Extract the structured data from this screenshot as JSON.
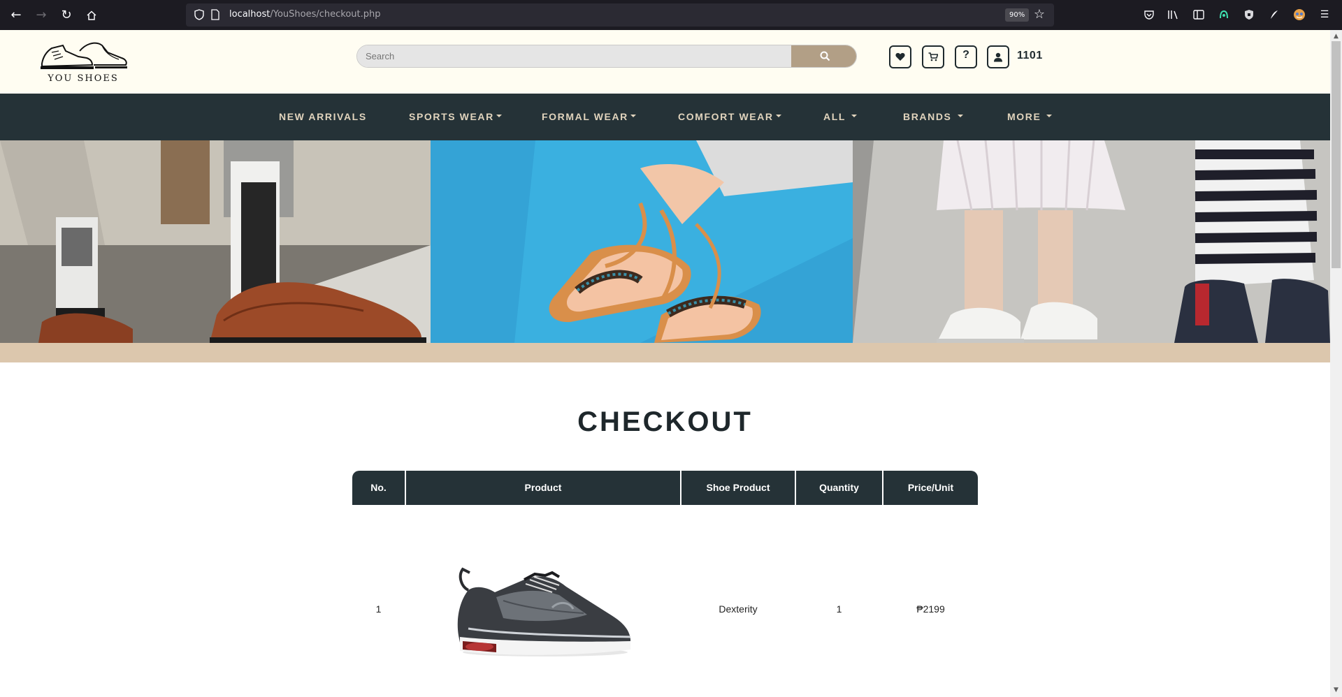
{
  "browser": {
    "url_host": "localhost",
    "url_path": "/YouShoes/checkout.php",
    "zoom": "90%",
    "icons": [
      "back-icon",
      "forward-icon",
      "reload-icon",
      "home-icon",
      "shield-icon",
      "page-icon",
      "bookmark-star-icon",
      "pocket-icon",
      "library-icon",
      "sidebar-icon",
      "extension-icon",
      "extension-shield-icon",
      "extension-feather-icon",
      "account-icon",
      "menu-icon"
    ]
  },
  "header": {
    "logo_text": "YOU SHOES",
    "search_placeholder": "Search",
    "user_id": "1101",
    "icons": [
      "heart-icon",
      "cart-icon",
      "help-icon",
      "user-icon",
      "search-icon"
    ]
  },
  "nav": {
    "items": [
      {
        "label": "NEW ARRIVALS",
        "dropdown": false
      },
      {
        "label": "SPORTS WEAR",
        "dropdown": true
      },
      {
        "label": "FORMAL WEAR",
        "dropdown": true
      },
      {
        "label": "COMFORT WEAR",
        "dropdown": true
      },
      {
        "label": "ALL",
        "dropdown": true
      },
      {
        "label": "BRANDS",
        "dropdown": true
      },
      {
        "label": "MORE",
        "dropdown": true
      }
    ]
  },
  "colors": {
    "nav_bg": "#253237",
    "nav_text": "#e1d4bd",
    "header_bg": "#fffdf2",
    "accent_tan": "#b29f86",
    "band_tan": "#dcc7ad"
  },
  "checkout": {
    "title": "CHECKOUT",
    "columns": [
      "No.",
      "Product",
      "Shoe Product",
      "Quantity",
      "Price/Unit"
    ],
    "rows": [
      {
        "no": "1",
        "shoe_product": "Dexterity",
        "quantity": "1",
        "price": "₱2199"
      }
    ]
  }
}
